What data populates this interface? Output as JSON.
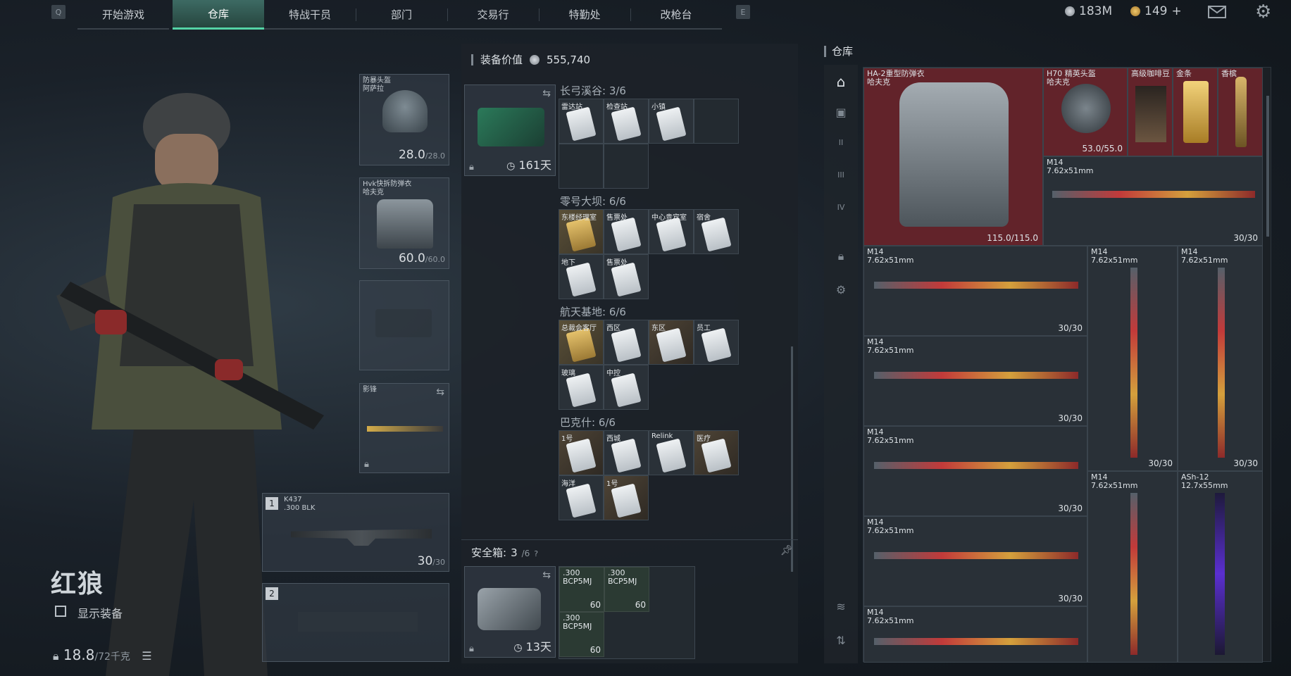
{
  "nav": {
    "left_key": "Q",
    "right_key": "E",
    "tabs": [
      "开始游戏",
      "仓库",
      "特战干员",
      "部门",
      "交易行",
      "特勤处",
      "改枪台"
    ],
    "active_tab": 1,
    "currency1": "183M",
    "currency2": "149",
    "currency2_plus": "+",
    "icons": [
      "mail-icon",
      "gear-icon"
    ]
  },
  "operator": {
    "name": "红狼",
    "show_gear_label": "显示装备",
    "weight": "18.8",
    "weight_max": "/72千克"
  },
  "slots": {
    "helmet": {
      "label1": "防暴头盔",
      "label2": "阿萨拉",
      "dur": "28.0",
      "dur_max": "/28.0"
    },
    "armor": {
      "label1": "Hvk快拆防弹衣",
      "label2": "哈夫克",
      "dur": "60.0",
      "dur_max": "/60.0"
    },
    "melee": {
      "label": "影锋"
    },
    "primary": {
      "num": "1",
      "name": "K437",
      "cal": ".300 BLK",
      "ammo": "30",
      "ammo_max": "/30"
    },
    "secondary": {
      "num": "2"
    }
  },
  "middle": {
    "equip_value_label": "装备价值",
    "equip_value": "555,740",
    "keycase_days": "161天",
    "groups": [
      {
        "title": "长弓溪谷: 3/6",
        "cells": [
          "雷达站",
          "检查站",
          "小镇"
        ]
      },
      {
        "title": "零号大坝: 6/6",
        "cells": [
          "东楼经理室",
          "售票处",
          "中心贵宾室",
          "宿舍",
          "地下",
          "售票处"
        ]
      },
      {
        "title": "航天基地: 6/6",
        "cells": [
          "总裁会客厅",
          "西区",
          "东区",
          "员工",
          "玻璃",
          "中控"
        ]
      },
      {
        "title": "巴克什: 6/6",
        "cells": [
          "1号",
          "西城",
          "Relink",
          "医疗",
          "海洋",
          "1号"
        ]
      }
    ],
    "safe_box_label": "安全箱:",
    "safe_box_count": "3",
    "safe_box_max": "/6",
    "safe_box_help": "?",
    "safe_days": "13天",
    "ammo": [
      {
        "cal": ".300",
        "name": "BCP5MJ",
        "count": "60"
      },
      {
        "cal": ".300",
        "name": "BCP5MJ",
        "count": "60"
      },
      {
        "cal": ".300",
        "name": "BCP5MJ",
        "count": "60"
      }
    ]
  },
  "stash": {
    "title": "仓库",
    "armor_name1": "HA-2重型防弹衣",
    "armor_name2": "哈夫克",
    "armor_dur": "115.0/115.0",
    "helmet_name1": "H70 精英头盔",
    "helmet_name2": "哈夫克",
    "helmet_dur": "53.0/55.0",
    "coffee": "高级咖啡豆",
    "gold": "金条",
    "champagne": "香槟",
    "gun_name": "M14",
    "gun_cal": "7.62x51mm",
    "gun_ammo": "30/30",
    "ash_name": "ASh-12",
    "ash_cal": "12.7x55mm",
    "sidebar_labels": [
      "II",
      "III",
      "IV"
    ]
  },
  "colors": {
    "accent": "#54d3a6",
    "red_item": "#6e242c",
    "panel": "#1c2228"
  }
}
